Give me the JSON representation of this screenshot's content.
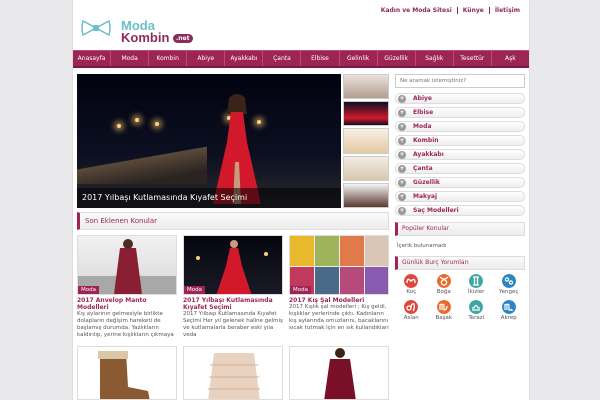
{
  "brand": {
    "moda": "Moda",
    "kombin": "Kombin",
    "net": ".net"
  },
  "toplinks": [
    "Kadın ve Moda Sitesi",
    "Künye",
    "İletişim"
  ],
  "nav": [
    "Anasayfa",
    "Moda",
    "Kombin",
    "Abiye",
    "Ayakkabı",
    "Çanta",
    "Elbise",
    "Gelinlik",
    "Güzellik",
    "Sağlık",
    "Tesettür",
    "Aşk"
  ],
  "slider": {
    "caption": "2017 Yılbaşı Kutlamasında Kıyafet Seçimi"
  },
  "section": {
    "latest": "Son Eklenen Konular"
  },
  "posts": [
    {
      "tag": "Moda",
      "title": "2017 Anvelop Manto Modelleri",
      "excerpt": "Kış aylarının gelmesiyle birlikte dolapların değişim hareketi de başlamış durumda. Yazlıkların kaldırılıp, yerine kışlıkların çıkmaya"
    },
    {
      "tag": "Moda",
      "title": "2017 Yılbaşı Kutlamasında Kıyafet Seçimi",
      "excerpt": "2017 Yılbaşı Kutlamasında Kıyafet Seçimi Her yıl gelenek haline gelmiş ve kutlamalarla beraber eski yıla veda"
    },
    {
      "tag": "Moda",
      "title": "2017 Kış Şal Modelleri",
      "excerpt": "2017 Kışlık şal modelleri ; Kış geldi, kışlıklar yerlerinde çıktı. Kadınların kış aylarında omuzlarını, bacaklarını sıcak tutmak için en sık kullandıkları kışlık"
    }
  ],
  "sidebar": {
    "search_placeholder": "Ne aramak istemiştiniz?",
    "categories": [
      "Abiye",
      "Elbise",
      "Moda",
      "Kombin",
      "Ayakkabı",
      "Çanta",
      "Güzellik",
      "Makyaj",
      "Saç Modelleri"
    ],
    "popular_title": "Popüler Konular",
    "popular_empty": "İçerik bulunamadı",
    "horoscope_title": "Günlük Burç Yorumları",
    "signs": [
      "Koç",
      "Boğa",
      "İkizler",
      "Yengeç",
      "Aslan",
      "Başak",
      "Terazi",
      "Akrep"
    ]
  },
  "colors": {
    "brand": "#9d2556",
    "accent": "#6cc0c9"
  }
}
